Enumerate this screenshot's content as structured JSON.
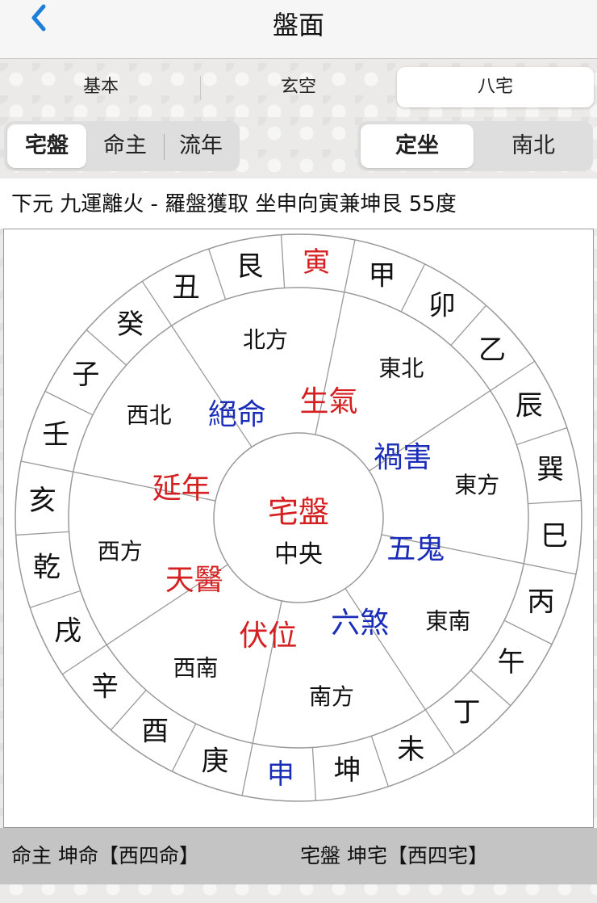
{
  "nav": {
    "title": "盤面",
    "back_icon": "chevron-left-icon"
  },
  "top_tabs": [
    {
      "label": "基本",
      "active": false
    },
    {
      "label": "玄空",
      "active": false
    },
    {
      "label": "八宅",
      "active": true
    }
  ],
  "left_pill": [
    {
      "label": "宅盤",
      "selected": true
    },
    {
      "label": "命主",
      "selected": false
    },
    {
      "label": "流年",
      "selected": false
    }
  ],
  "right_pill": [
    {
      "label": "定坐",
      "selected": true
    },
    {
      "label": "南北",
      "selected": false
    }
  ],
  "info_line": "下元 九運離火 - 羅盤獲取 坐申向寅兼坤艮 55度",
  "chart": {
    "center_title": "宅盤",
    "center_sub": "中央",
    "outer_ring": [
      "寅",
      "甲",
      "卯",
      "乙",
      "辰",
      "巽",
      "巳",
      "丙",
      "午",
      "丁",
      "未",
      "坤",
      "申",
      "庚",
      "酉",
      "辛",
      "戌",
      "乾",
      "亥",
      "壬",
      "子",
      "癸",
      "丑",
      "艮"
    ],
    "outer_highlight": {
      "寅": "#d42020",
      "申": "#1a2db8"
    },
    "sectors": [
      {
        "direction": "東方",
        "star": "禍害",
        "color": "#1a2db8"
      },
      {
        "direction": "東南",
        "star": "五鬼",
        "color": "#1a2db8"
      },
      {
        "direction": "南方",
        "star": "六煞",
        "color": "#1a2db8"
      },
      {
        "direction": "西南",
        "star": "伏位",
        "color": "#d42020"
      },
      {
        "direction": "西方",
        "star": "天醫",
        "color": "#d42020"
      },
      {
        "direction": "西北",
        "star": "延年",
        "color": "#d42020"
      },
      {
        "direction": "北方",
        "star": "絕命",
        "color": "#1a2db8"
      },
      {
        "direction": "東北",
        "star": "生氣",
        "color": "#d42020"
      }
    ]
  },
  "footer": {
    "left": "命主 坤命【西四命】",
    "right": "宅盤 坤宅【西四宅】"
  },
  "colors": {
    "red": "#d42020",
    "blue": "#1a2db8",
    "accent": "#1e7fd8"
  }
}
